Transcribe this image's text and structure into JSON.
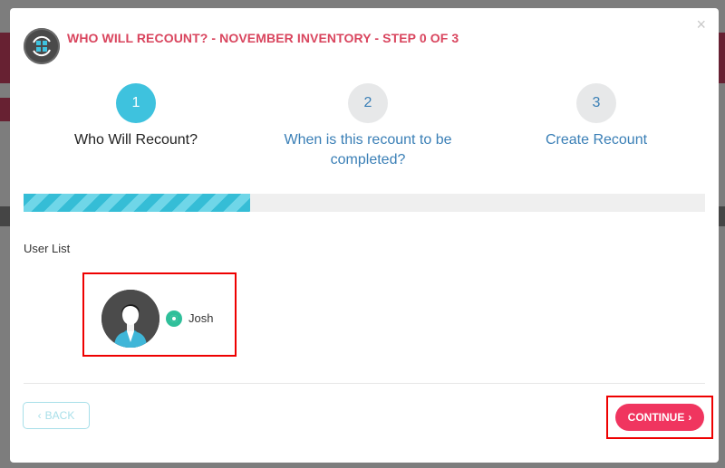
{
  "modal": {
    "title": "WHO WILL RECOUNT? - NOVEMBER INVENTORY - STEP 0 OF 3",
    "close_label": "×"
  },
  "steps": [
    {
      "number": "1",
      "label": "Who Will Recount?",
      "state": "active"
    },
    {
      "number": "2",
      "label": "When is this recount to be completed?",
      "state": "inactive"
    },
    {
      "number": "3",
      "label": "Create Recount",
      "state": "inactive"
    }
  ],
  "progress": {
    "fraction": 0.333
  },
  "user_list": {
    "label": "User List",
    "users": [
      {
        "name": "Josh",
        "selected": true
      }
    ]
  },
  "footer": {
    "back_label": "BACK",
    "back_icon": "chevron-left-icon",
    "continue_label": "CONTINUE",
    "continue_icon": "chevron-right-icon"
  },
  "colors": {
    "accent_red": "#d9455e",
    "continue_bg": "#f0355f",
    "step_active": "#3ec2de",
    "step_link": "#3a7fb6",
    "radio": "#2fbf9a"
  }
}
